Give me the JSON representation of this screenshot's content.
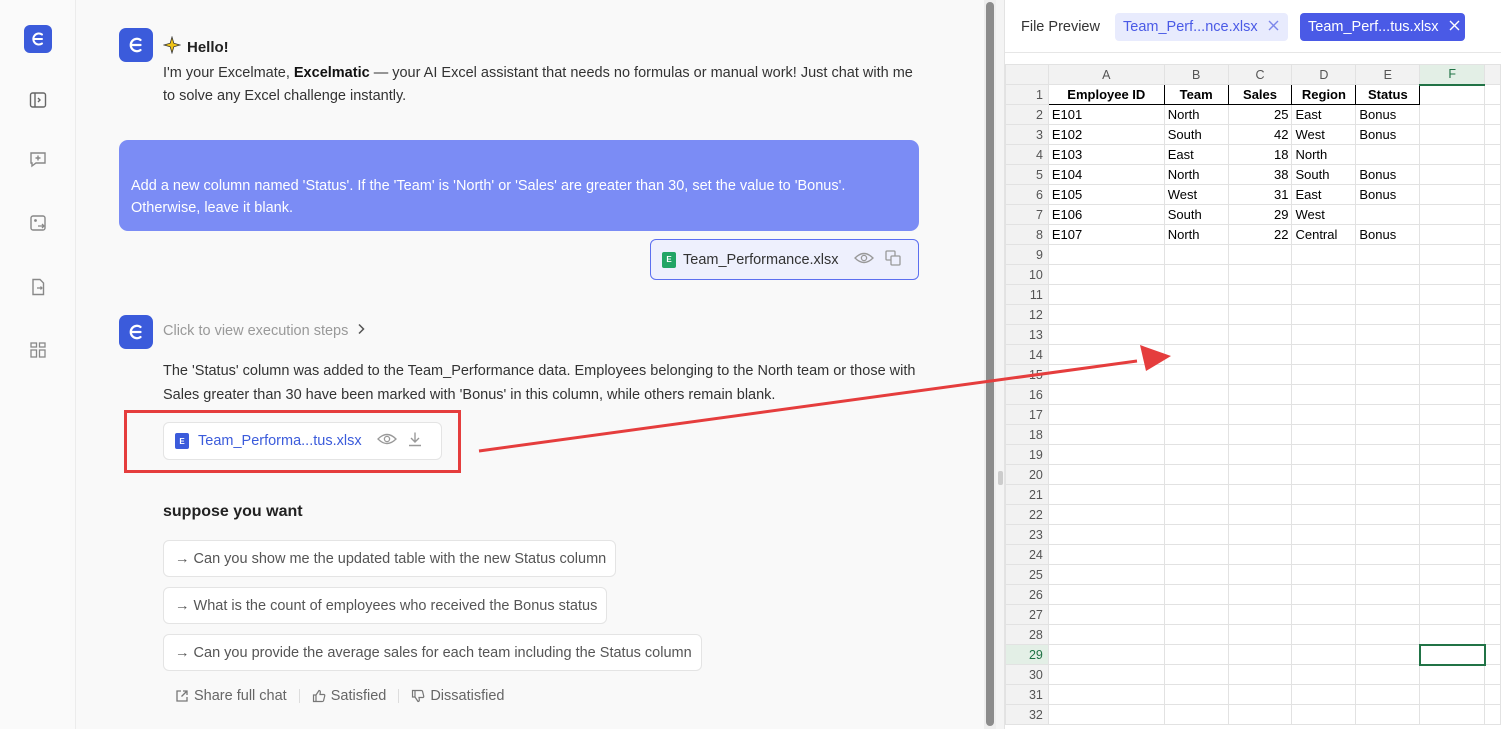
{
  "chat": {
    "greeting": "Hello!",
    "intro_pre": "I'm your Excelmate, ",
    "intro_bold": "Excelmatic",
    "intro_post": " — your AI Excel assistant that needs no formulas or manual work! Just chat with me to solve any Excel challenge instantly.",
    "user_message": "Add a new column named 'Status'. If the 'Team' is 'North' or 'Sales' are greater than 30, set the value to 'Bonus'. Otherwise, leave it blank.",
    "user_file": "Team_Performance.xlsx",
    "steps_label": "Click to view execution steps",
    "reply": "The 'Status' column was added to the Team_Performance data. Employees belonging to the North team or those with Sales greater than 30 have been marked with 'Bonus' in this column, while others remain blank.",
    "output_file": "Team_Performa...tus.xlsx",
    "suppose_title": "suppose you want",
    "suggestions": [
      "→ Can you show me the updated table with the new Status column",
      "→ What is the count of employees who received the Bonus status",
      "→ Can you provide the average sales for each team including the Status column"
    ],
    "feedback": {
      "share": "Share full chat",
      "satisfied": "Satisfied",
      "dissatisfied": "Dissatisfied"
    }
  },
  "preview": {
    "title": "File Preview",
    "tabs": [
      "Team_Perf...nce.xlsx",
      "Team_Perf...tus.xlsx"
    ],
    "columns": [
      "A",
      "B",
      "C",
      "D",
      "E",
      "F"
    ],
    "header_row": [
      "Employee ID",
      "Team",
      "Sales",
      "Region",
      "Status"
    ],
    "rows": [
      [
        "E101",
        "North",
        "25",
        "East",
        "Bonus"
      ],
      [
        "E102",
        "South",
        "42",
        "West",
        "Bonus"
      ],
      [
        "E103",
        "East",
        "18",
        "North",
        ""
      ],
      [
        "E104",
        "North",
        "38",
        "South",
        "Bonus"
      ],
      [
        "E105",
        "West",
        "31",
        "East",
        "Bonus"
      ],
      [
        "E106",
        "South",
        "29",
        "West",
        ""
      ],
      [
        "E107",
        "North",
        "22",
        "Central",
        "Bonus"
      ]
    ],
    "total_rows": 32,
    "selected_column": "F",
    "selected_row": 29
  },
  "colors": {
    "brand": "#3b5bdb",
    "user_bubble": "#7b8cf5",
    "highlight": "#e53d3d",
    "excel_green": "#217346"
  }
}
